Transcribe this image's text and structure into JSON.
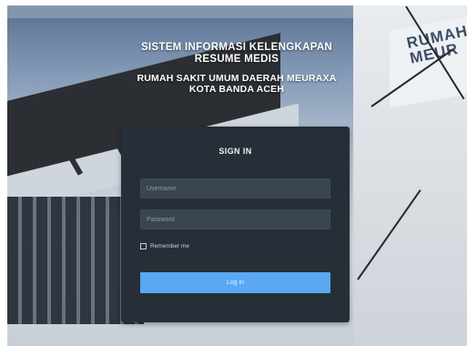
{
  "header": {
    "title_lines": [
      "SISTEM INFORMASI KELENGKAPAN",
      "RESUME MEDIS"
    ],
    "subtitle_lines": [
      "RUMAH SAKIT UMUM DAERAH MEURAXA",
      "KOTA BANDA ACEH"
    ]
  },
  "background": {
    "building_sign_lines": [
      "RUMAH",
      "MEUR"
    ]
  },
  "login": {
    "heading": "SIGN IN",
    "username_placeholder": "Username",
    "password_placeholder": "Password",
    "remember_label": "Remember me",
    "remember_checked": false,
    "button_label": "Log in"
  },
  "colors": {
    "card": "#262f37",
    "field": "#39454f",
    "button": "#5aa7f2"
  }
}
